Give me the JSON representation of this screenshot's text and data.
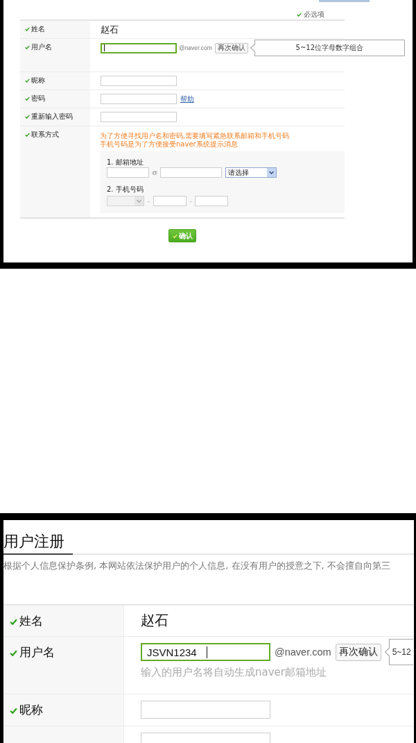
{
  "top_form": {
    "required_note": "必选项",
    "rows": [
      {
        "kind": "text",
        "label": "姓名",
        "required": true,
        "value": "赵石"
      },
      {
        "kind": "username",
        "label": "用户名",
        "required": true,
        "focused": true,
        "domain": "@naver.com",
        "recheck_button": "再次确认",
        "tooltip": "5~12位字母数字组合"
      },
      {
        "kind": "input",
        "label": "昵称",
        "required": true
      },
      {
        "kind": "input",
        "label": "密码",
        "required": true,
        "link": "帮助"
      },
      {
        "kind": "input",
        "label": "重新输入密码",
        "required": true
      },
      {
        "kind": "contact",
        "label": "联系方式",
        "required": true,
        "notes": [
          "为了方便寻找用户名和密码,需要填写紧急联系邮箱和手机号码",
          "手机号码是为了方便接受naver系统提示消息"
        ],
        "email_label": "1. 邮箱地址",
        "at": "@",
        "domain_select": {
          "value": "请选择",
          "disabled": false
        },
        "phone_label": "2. 手机号码",
        "phone_prefix": {
          "disabled": true
        },
        "separators": [
          "-",
          "-"
        ]
      }
    ],
    "submit_button": "确认"
  },
  "bottom_form": {
    "title": "用户注册",
    "notice": "根据个人信息保护条例, 本网站依法保护用户的个人信息, 在没有用户的授意之下, 不会擅自向第三",
    "rows": [
      {
        "kind": "text",
        "label": "姓名",
        "required": true,
        "value": "赵石"
      },
      {
        "kind": "username",
        "label": "用户名",
        "required": true,
        "value": "JSVN1234",
        "focused": true,
        "domain": "@naver.com",
        "recheck_button": "再次确认",
        "tooltip": "5~12",
        "hint": "输入的用户名将自动生成naver邮箱地址"
      },
      {
        "kind": "input",
        "label": "昵称",
        "required": true
      },
      {
        "kind": "input"
      }
    ]
  }
}
